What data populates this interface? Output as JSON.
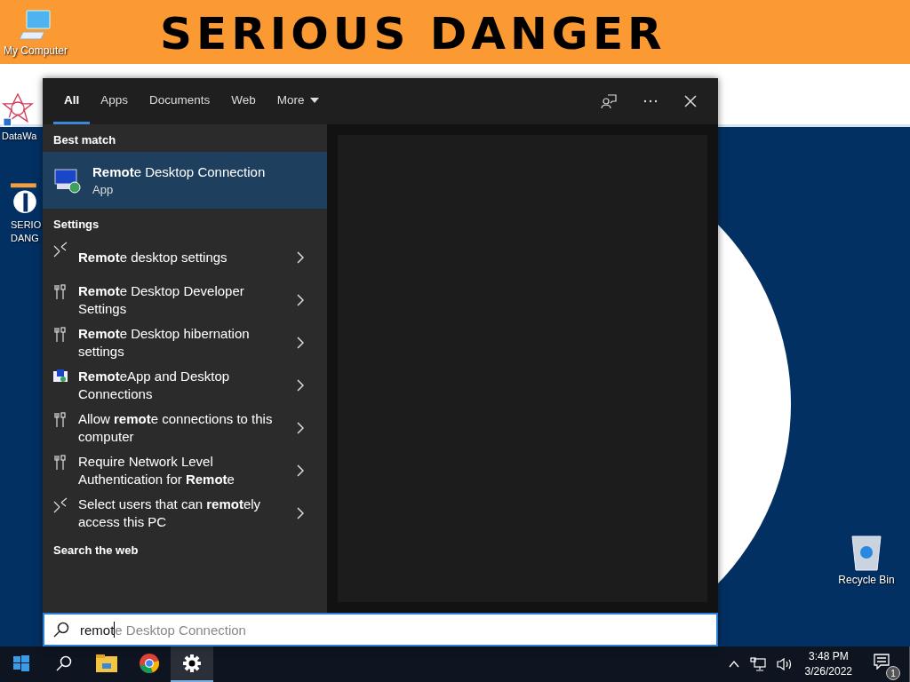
{
  "wallpaper": {
    "banner": "SERIOUS DANGER"
  },
  "desktop_icons": [
    {
      "label": "My Computer",
      "kind": "computer"
    },
    {
      "label": "DataWa",
      "kind": "star"
    },
    {
      "label": "SERIO DANG",
      "kind": "logo"
    },
    {
      "label": "Recycle Bin",
      "kind": "bin"
    }
  ],
  "search_panel": {
    "tabs": [
      {
        "label": "All",
        "selected": true
      },
      {
        "label": "Apps",
        "selected": false
      },
      {
        "label": "Documents",
        "selected": false
      },
      {
        "label": "Web",
        "selected": false
      },
      {
        "label": "More",
        "selected": false,
        "dropdown": true
      }
    ],
    "best_match": {
      "heading": "Best match",
      "title": "**Remot**e Desktop Connection",
      "subtitle": "App",
      "selected": true
    },
    "settings": {
      "heading": "Settings",
      "items": [
        {
          "text": "**Remot**e desktop settings",
          "kind": "cross"
        },
        {
          "text": "**Remot**e Desktop Developer Settings",
          "kind": "tools"
        },
        {
          "text": "**Remot**e Desktop hibernation settings",
          "kind": "tools"
        },
        {
          "text": "**Remot**eApp and Desktop Connections",
          "kind": "app"
        },
        {
          "text": "Allow **remot**e connections to this computer",
          "kind": "tools"
        },
        {
          "text": "Require Network Level Authentication for **Remot**e",
          "kind": "tools"
        },
        {
          "text": "Select users that can **remot**ely access this PC",
          "kind": "cross"
        }
      ]
    },
    "web": {
      "heading": "Search the web"
    },
    "search_box": {
      "value": "remot",
      "suggestion": "e Desktop Connection"
    }
  },
  "taskbar": {
    "apps": [
      {
        "kind": "explorer",
        "active": false
      },
      {
        "kind": "chrome",
        "active": false
      },
      {
        "kind": "settings",
        "active": true
      }
    ],
    "time": "3:48 PM",
    "date": "3/26/2022",
    "notifications": "1"
  }
}
